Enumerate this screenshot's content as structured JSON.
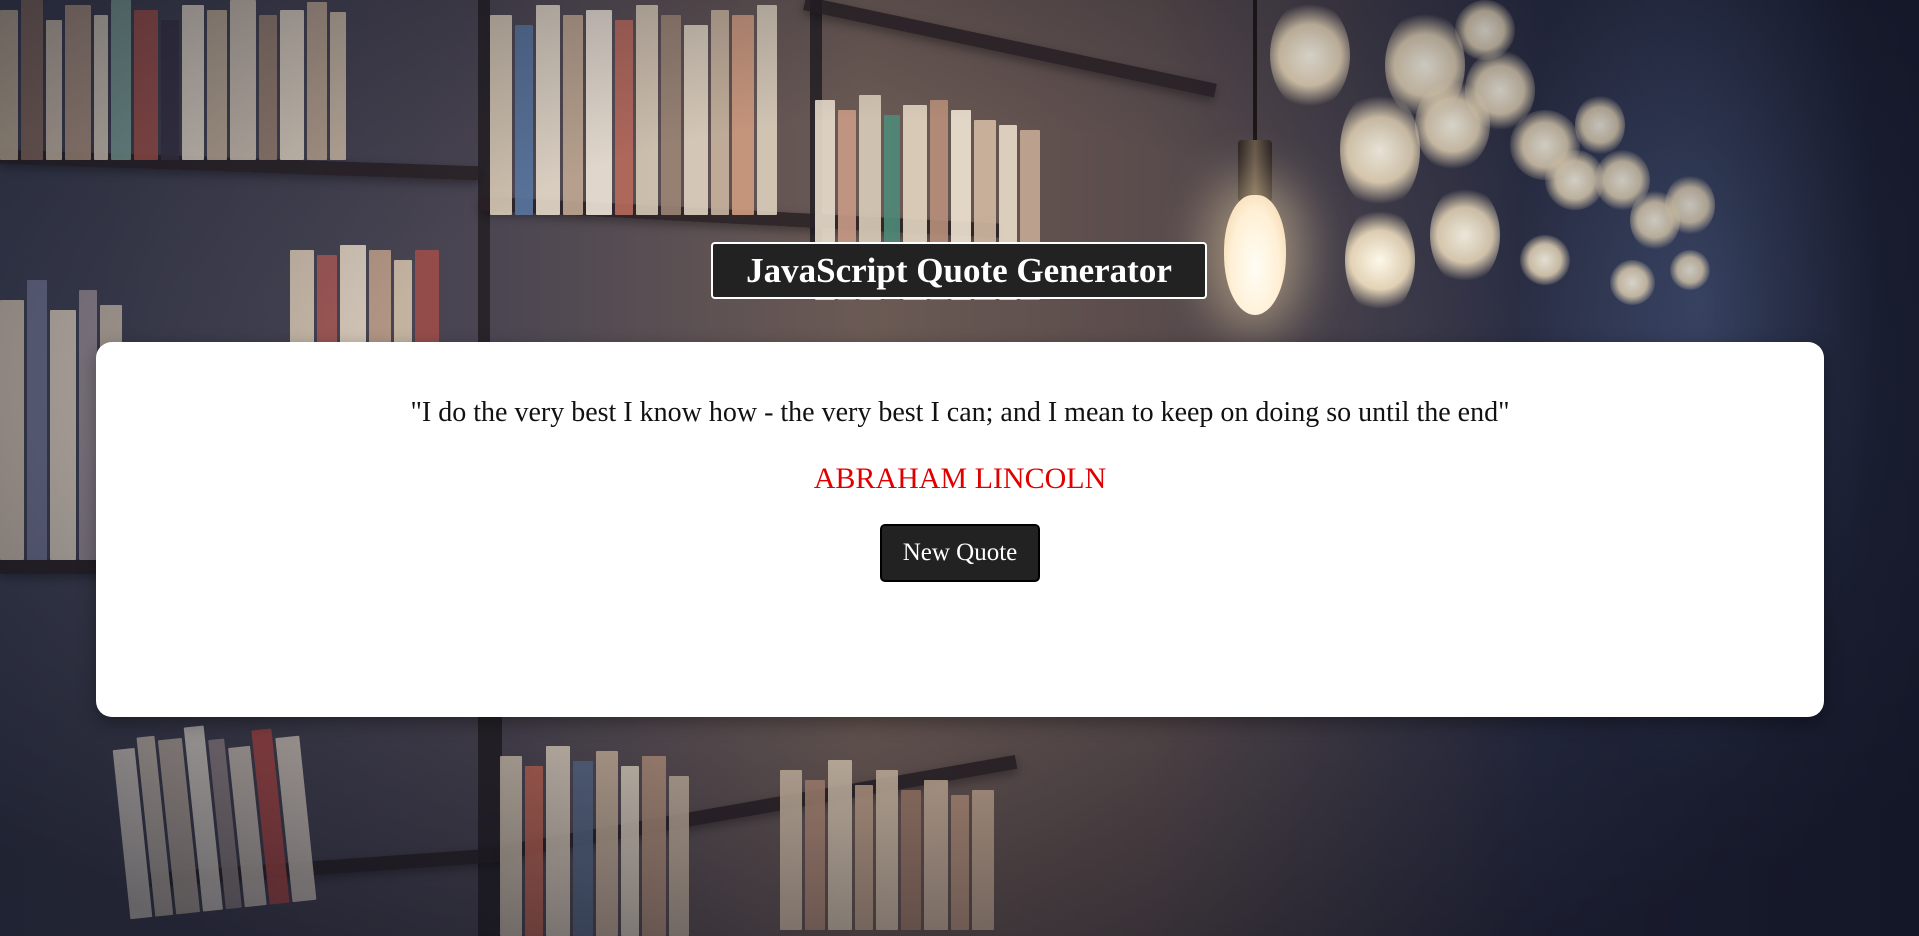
{
  "header": {
    "title": "JavaScript Quote Generator"
  },
  "quote": {
    "text": "\"I do the very best I know how - the very best I can; and I mean to keep on doing so until the end\"",
    "author": "ABRAHAM LINCOLN",
    "button_label": "New Quote"
  },
  "colors": {
    "title_background": "#222222",
    "card_background": "#ffffff",
    "author_text": "#e00000",
    "button_background": "#222222"
  },
  "background": {
    "description_icon": "library-bookshelf-background"
  }
}
